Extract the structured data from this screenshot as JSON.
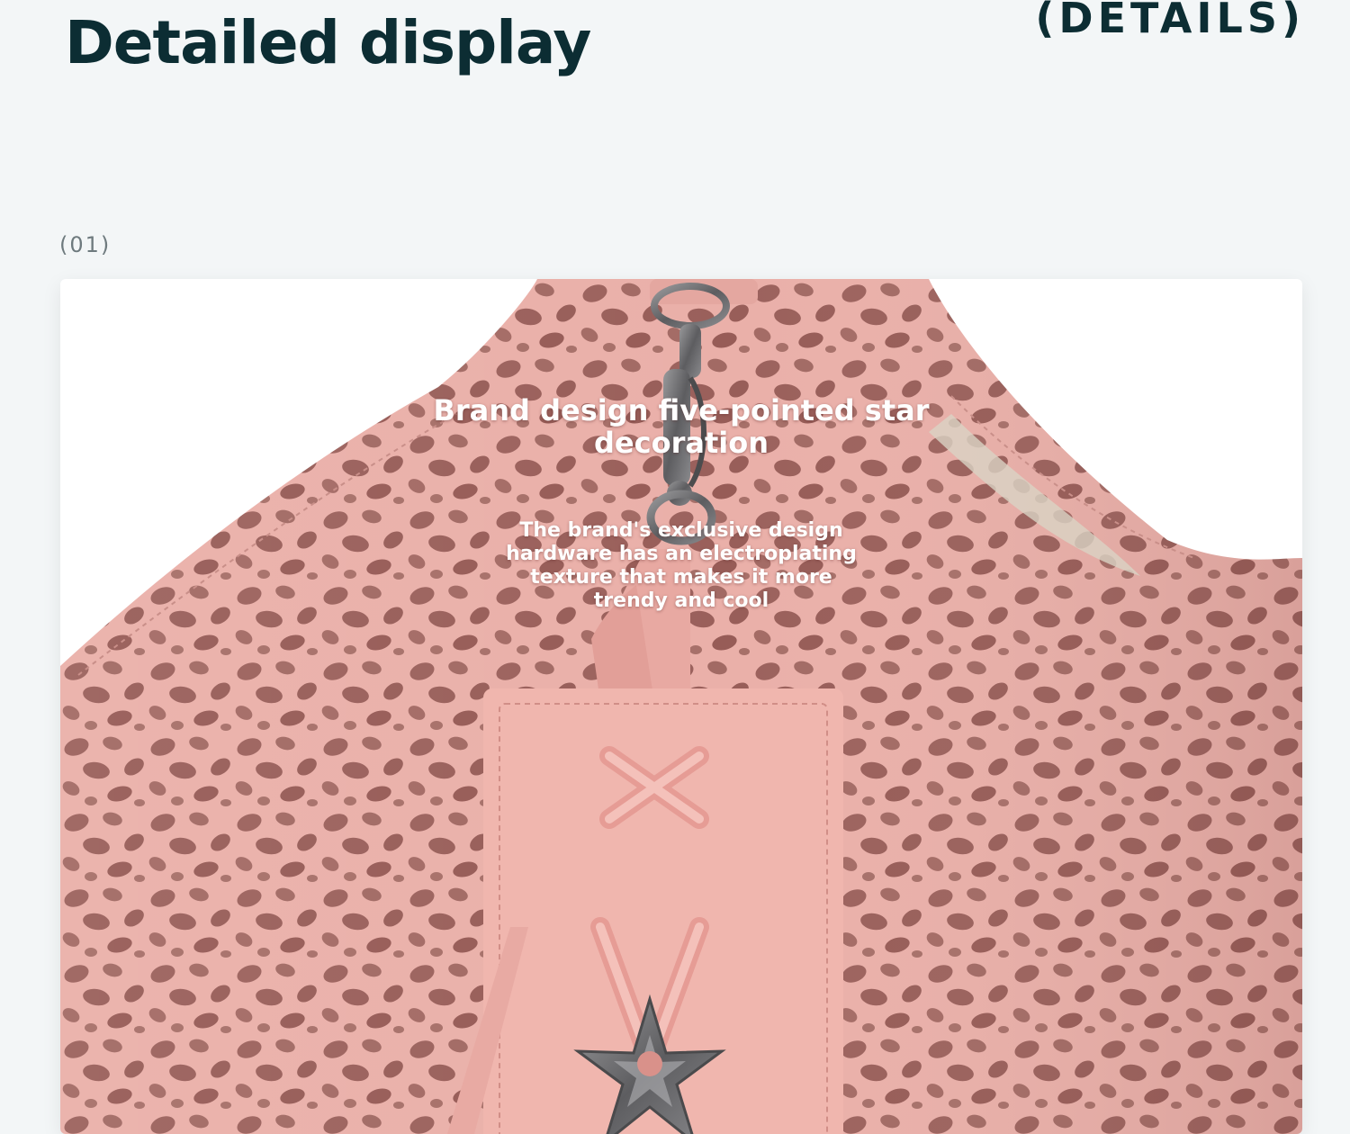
{
  "header": {
    "title": "Detailed display",
    "tag": "(DETAILS)"
  },
  "item": {
    "number": "(01)",
    "caption_title": "Brand design five-pointed star decoration",
    "caption_body": "The brand's exclusive design hardware has an electroplating texture that makes it more trendy and cool"
  },
  "colors": {
    "heading": "#0c2d33",
    "background": "#f3f6f7",
    "leather_pink": "#e9a9a3",
    "leopard_spot": "#9a5f5a",
    "metal": "#6e6e70"
  },
  "icons": {
    "hardware": "five-pointed-star-icon",
    "clasp": "metal-clasp-icon"
  }
}
